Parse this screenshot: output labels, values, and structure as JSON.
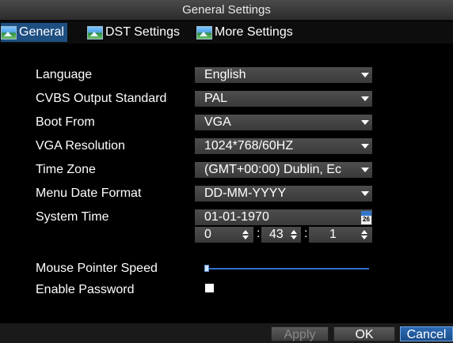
{
  "window": {
    "title": "General Settings"
  },
  "tabs": [
    {
      "label": "General",
      "icon": "landscape-icon",
      "active": true
    },
    {
      "label": "DST Settings",
      "icon": "landscape-icon",
      "active": false
    },
    {
      "label": "More Settings",
      "icon": "landscape-icon",
      "active": false
    }
  ],
  "form": {
    "language": {
      "label": "Language",
      "value": "English"
    },
    "cvbs": {
      "label": "CVBS Output Standard",
      "value": "PAL"
    },
    "boot_from": {
      "label": "Boot From",
      "value": "VGA"
    },
    "vga_resolution": {
      "label": "VGA Resolution",
      "value": "1024*768/60HZ"
    },
    "time_zone": {
      "label": "Time Zone",
      "value": "(GMT+00:00) Dublin, Ec"
    },
    "date_format": {
      "label": "Menu Date Format",
      "value": "DD-MM-YYYY"
    },
    "system_time": {
      "label": "System Time",
      "date": "01-01-1970",
      "hour": "0",
      "minute": "43",
      "second": "1",
      "separator": ":",
      "calendar_icon": "calendar-icon",
      "calendar_day": "26"
    },
    "mouse_speed": {
      "label": "Mouse Pointer Speed",
      "level": 0.0
    },
    "enable_password": {
      "label": "Enable Password",
      "checked": false
    }
  },
  "buttons": {
    "apply": {
      "label": "Apply",
      "enabled": false
    },
    "ok": {
      "label": "OK"
    },
    "cancel": {
      "label": "Cancel"
    }
  },
  "colors": {
    "accent": "#1e4f82",
    "slider": "#2f6fd0",
    "background": "#000000"
  }
}
